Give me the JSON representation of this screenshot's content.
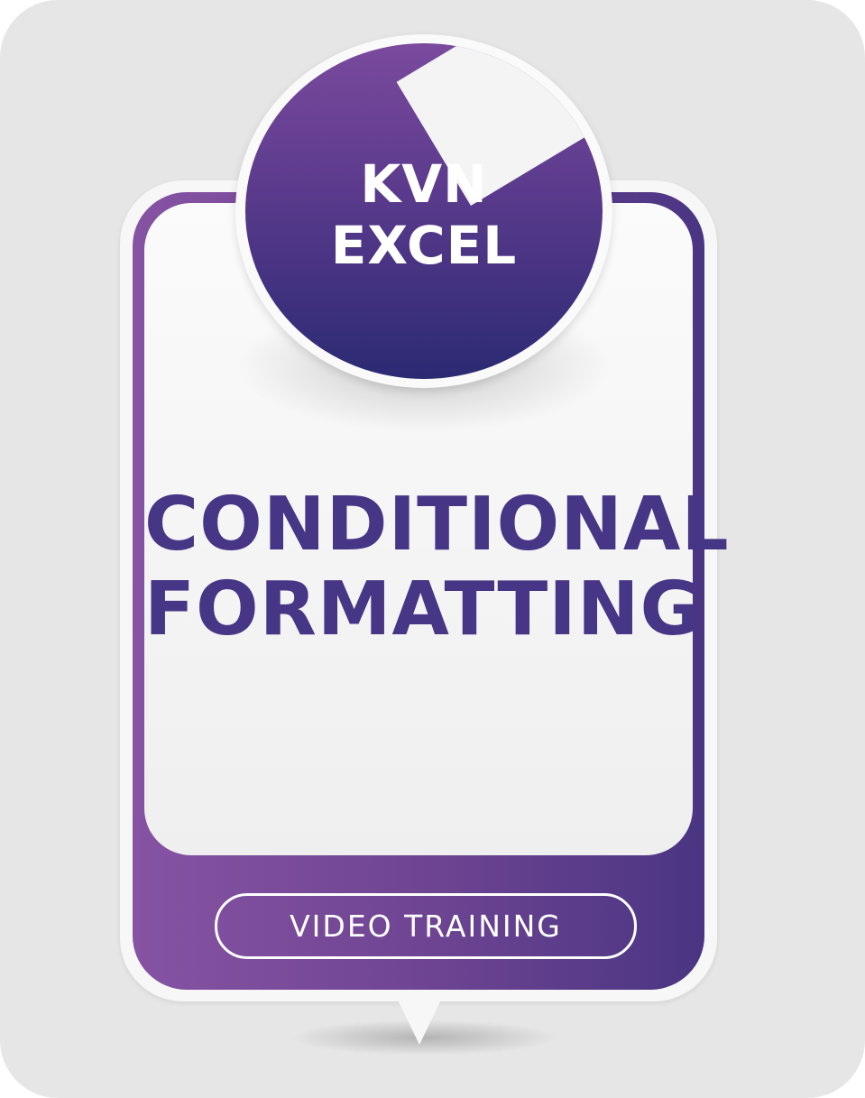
{
  "badge": {
    "line1": "KVN",
    "line2": "EXCEL"
  },
  "title": {
    "line1": "CONDITIONAL",
    "line2": "FORMATTING"
  },
  "button": {
    "label": "VIDEO TRAINING"
  },
  "colors": {
    "purple_light": "#8653a3",
    "purple_dark": "#4a3583",
    "title_text": "#473585",
    "background": "#e6e6e6"
  }
}
